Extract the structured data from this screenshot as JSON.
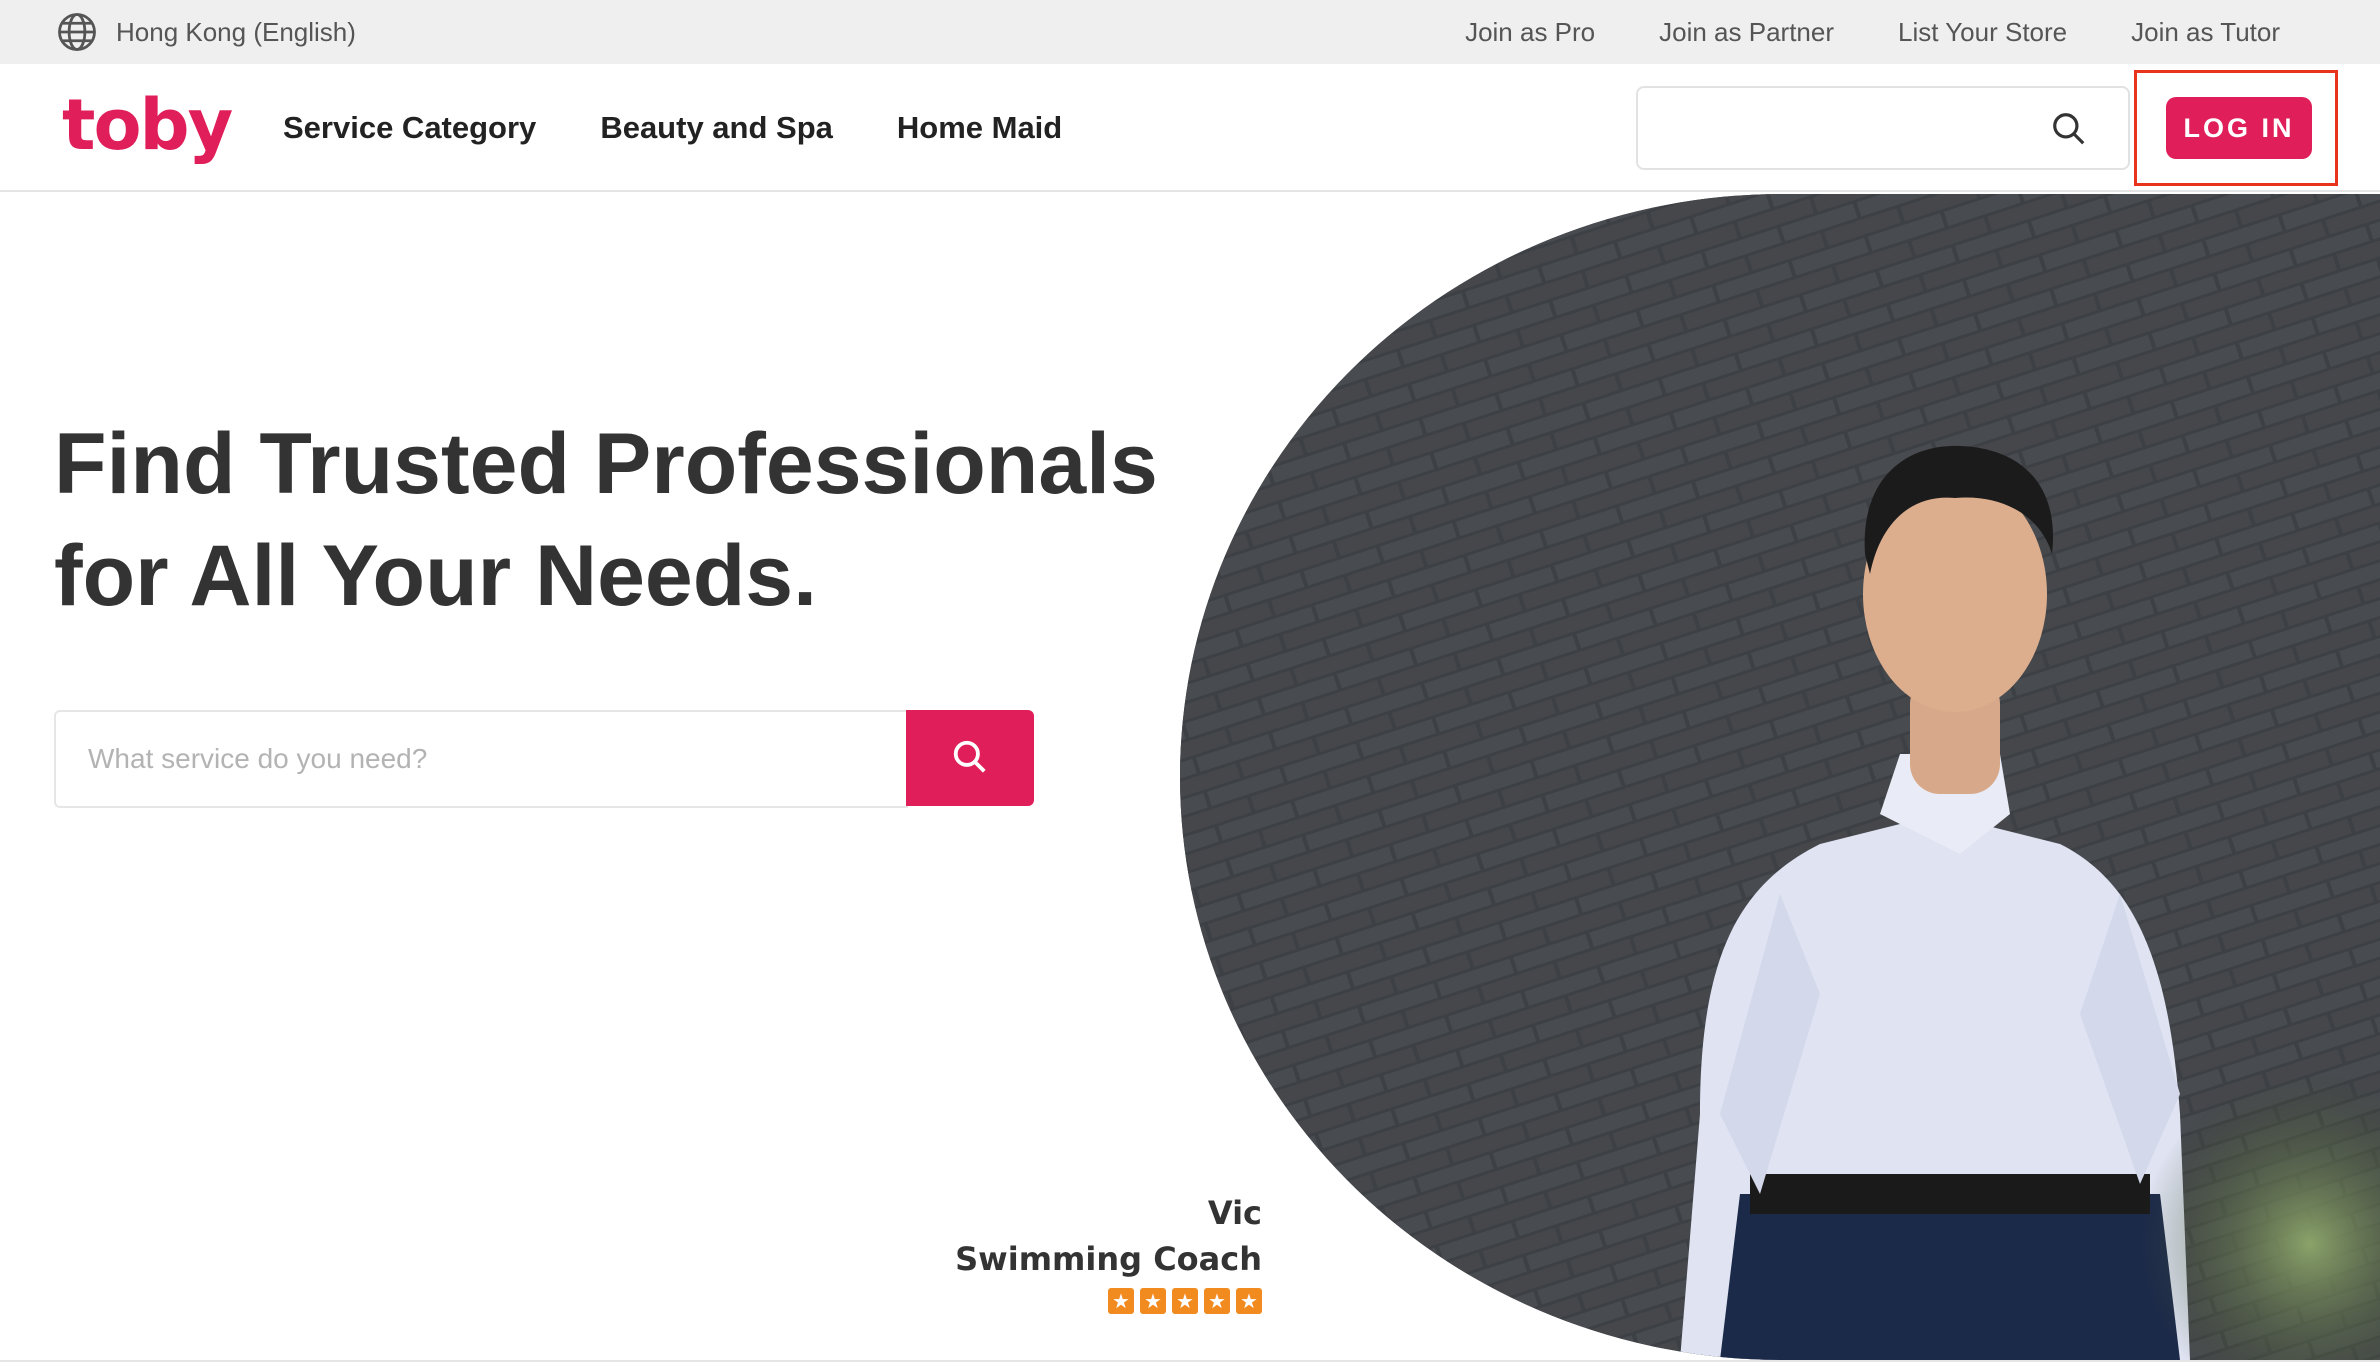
{
  "topbar": {
    "locale": "Hong Kong (English)",
    "links": [
      "Join as Pro",
      "Join as Partner",
      "List Your Store",
      "Join as Tutor"
    ]
  },
  "nav": {
    "logo": "toby",
    "links": [
      "Service Category",
      "Beauty and Spa",
      "Home Maid"
    ],
    "search_placeholder": "",
    "login_label": "LOG IN"
  },
  "hero": {
    "title_line1": "Find Trusted Professionals",
    "title_line2": "for All Your Needs.",
    "search_placeholder": "What service do you need?"
  },
  "featured_pro": {
    "name": "Vic",
    "role": "Swimming Coach",
    "rating": 5
  },
  "icons": [
    "globe-icon",
    "search-icon",
    "star-icon"
  ],
  "colors": {
    "brand": "#e01e5a",
    "highlight_outline": "#e8341c",
    "star": "#f28b1f"
  }
}
